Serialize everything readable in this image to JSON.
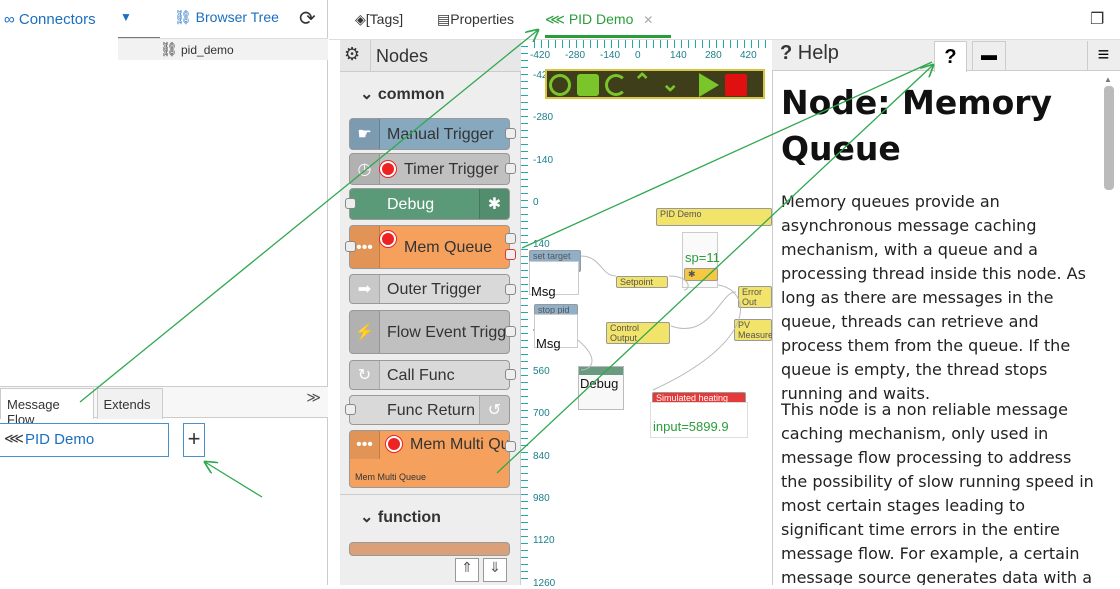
{
  "left": {
    "connectors": "Connectors",
    "browser_tree": "Browser Tree",
    "tree_item": "pid_demo",
    "tabs": [
      "Message Flow",
      "Extends"
    ],
    "flow_item": "PID Demo",
    "plus": "+"
  },
  "tabs": [
    {
      "label": "[Tags]",
      "icon": "tag-icon"
    },
    {
      "label": "Properties",
      "icon": "list-icon"
    },
    {
      "label": "PID Demo",
      "icon": "share-icon",
      "close": "✕"
    }
  ],
  "palette": {
    "title": "Nodes",
    "sections": [
      "common",
      "function"
    ],
    "nodes": [
      {
        "label": "Manual Trigger",
        "color": "#87a9c0"
      },
      {
        "label": "Timer Trigger",
        "color": "#c0c0c0"
      },
      {
        "label": "Debug",
        "color": "#5a9a78"
      },
      {
        "label": "Mem Queue",
        "color": "#f5a15d"
      },
      {
        "label": "Outer Trigger",
        "color": "#d9d9d9"
      },
      {
        "label": "Flow Event Trigg",
        "color": "#c0c0c0"
      },
      {
        "label": "Call Func",
        "color": "#d9d9d9"
      },
      {
        "label": "Func Return",
        "color": "#d9d9d9"
      },
      {
        "label": "Mem Multi Qu",
        "sub": "Mem Multi Queue",
        "color": "#f5a15d"
      }
    ]
  },
  "canvas": {
    "ruler_x": [
      "-420",
      "-280",
      "-140",
      "0",
      "140",
      "280",
      "420"
    ],
    "ruler_y": [
      "-420",
      "-280",
      "-140",
      "0",
      "140",
      "280",
      "420",
      "560",
      "700",
      "840",
      "980",
      "1120",
      "1260"
    ],
    "flow_title": "PID Demo",
    "msg1": "Msg",
    "msg2": "Msg",
    "debug": "Debug",
    "sp": "sp=11",
    "input": "input=5899.9",
    "mini_nodes": [
      "set target T",
      "Setpoint",
      "stop pid",
      "Control Output",
      "Error Out",
      "PV Measure",
      "Simulated heating Furnace"
    ]
  },
  "help": {
    "tab_title": "Help",
    "q": "?",
    "title": "Node: Memory Queue",
    "paragraphs": [
      "Memory queues provide an asynchronous message caching mechanism, with a queue and a processing thread inside this node. As long as there are messages in the queue, threads can retrieve and process them from the queue. If the queue is empty, the thread stops running and waits.",
      "This node is a non reliable message caching mechanism, only used in message flow processing to address the possibility of slow running speed in most certain stages leading to significant time errors in the entire message flow. For example, a certain message source generates data with a high frequency, but"
    ]
  },
  "colors": {
    "accent": "#2a9d3a",
    "link": "#1a6fc0",
    "toolbar_border": "#d6c640"
  }
}
